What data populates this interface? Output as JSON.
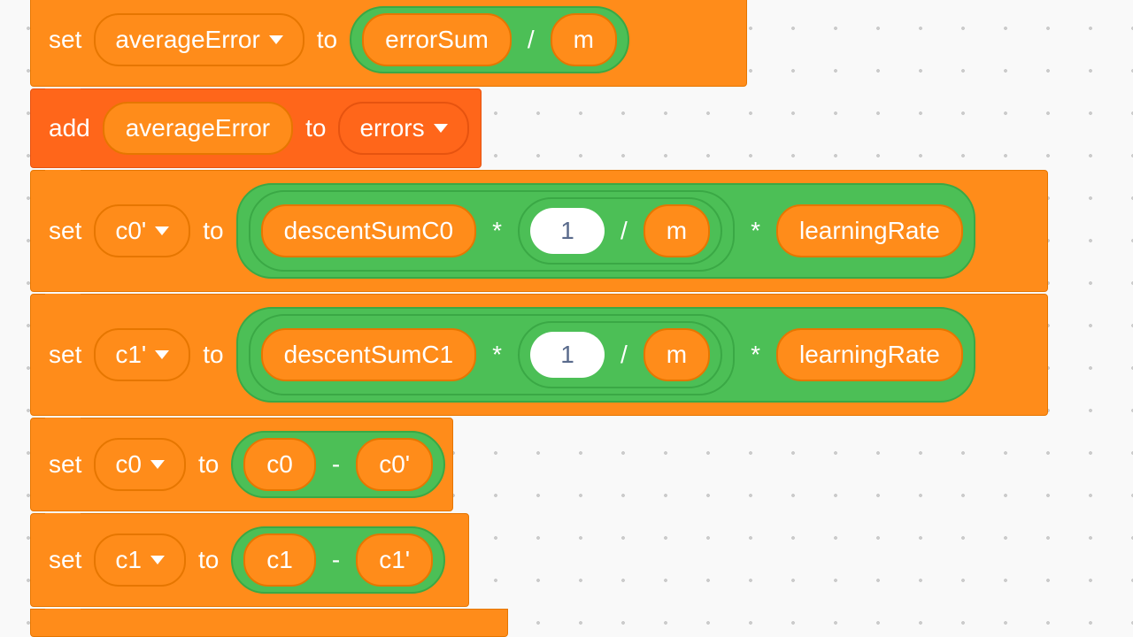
{
  "rows": {
    "r1": {
      "kw_set": "set",
      "var": "averageError",
      "kw_to": "to",
      "lhs": "errorSum",
      "sym": "/",
      "rhs": "m"
    },
    "r2": {
      "kw_add": "add",
      "item": "averageError",
      "kw_to": "to",
      "list": "errors"
    },
    "r3": {
      "kw_set": "set",
      "var": "c0'",
      "kw_to": "to",
      "outer_lhs_var": "descentSumC0",
      "outer_sym1": "*",
      "inner_num": "1",
      "inner_sym": "/",
      "inner_rhs": "m",
      "outer_sym2": "*",
      "outer_rhs": "learningRate"
    },
    "r4": {
      "kw_set": "set",
      "var": "c1'",
      "kw_to": "to",
      "outer_lhs_var": "descentSumC1",
      "outer_sym1": "*",
      "inner_num": "1",
      "inner_sym": "/",
      "inner_rhs": "m",
      "outer_sym2": "*",
      "outer_rhs": "learningRate"
    },
    "r5": {
      "kw_set": "set",
      "var": "c0",
      "kw_to": "to",
      "lhs": "c0",
      "sym": "-",
      "rhs": "c0'"
    },
    "r6": {
      "kw_set": "set",
      "var": "c1",
      "kw_to": "to",
      "lhs": "c1",
      "sym": "-",
      "rhs": "c1'"
    }
  }
}
